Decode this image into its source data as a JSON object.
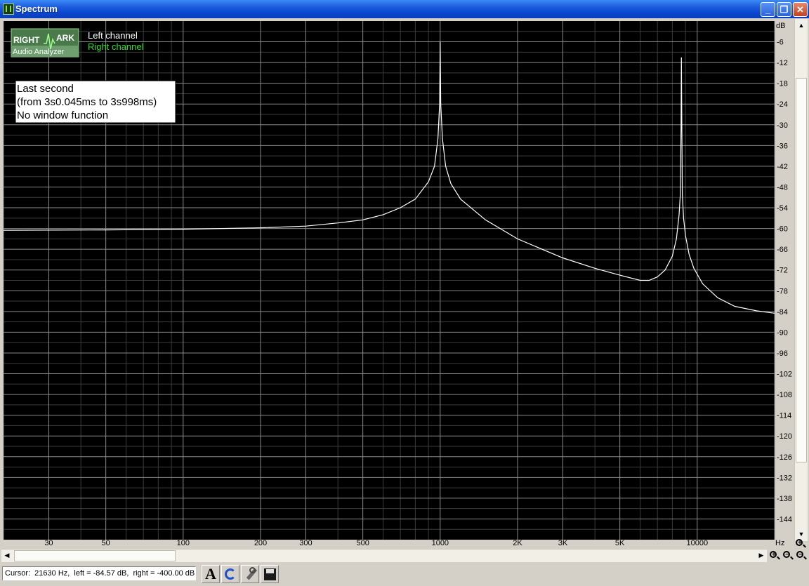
{
  "window": {
    "title": "Spectrum",
    "controls": {
      "minimize": "_",
      "maximize": "❐",
      "close": "✕"
    }
  },
  "logo": {
    "line1": "RIGHT",
    "line2": "ARK",
    "line3": "Audio Analyzer"
  },
  "legend": [
    {
      "label": "Left channel",
      "color": "#ffffff"
    },
    {
      "label": "Right channel",
      "color": "#33dd33"
    }
  ],
  "info_box": [
    "Last second",
    "(from 3s0.045ms to 3s998ms)",
    "No window function"
  ],
  "status": {
    "cursor_text": "Cursor:  21630 Hz,  left = -84.57 dB,  right = -400.00 dB"
  },
  "colors": {
    "plot_background": "#000000",
    "major_grid": "#8a8a8a",
    "minor_grid": "#3c3c3c",
    "left_trace": "#ffffff",
    "axis_background": "#d4d0c8"
  },
  "chart_data": {
    "type": "line",
    "x_scale": "log",
    "xlim": [
      20,
      20000
    ],
    "ylim": [
      -150,
      0
    ],
    "ylabel": "dB",
    "xlabel": "Hz",
    "x_ticks": [
      {
        "v": 30,
        "label": "30"
      },
      {
        "v": 50,
        "label": "50"
      },
      {
        "v": 100,
        "label": "100"
      },
      {
        "v": 200,
        "label": "200"
      },
      {
        "v": 300,
        "label": "300"
      },
      {
        "v": 500,
        "label": "500"
      },
      {
        "v": 1000,
        "label": "1000"
      },
      {
        "v": 2000,
        "label": "2K"
      },
      {
        "v": 3000,
        "label": "3K"
      },
      {
        "v": 5000,
        "label": "5K"
      },
      {
        "v": 10000,
        "label": "10000"
      }
    ],
    "y_ticks": [
      -6,
      -12,
      -18,
      -24,
      -30,
      -36,
      -42,
      -48,
      -54,
      -60,
      -66,
      -72,
      -78,
      -84,
      -90,
      -96,
      -102,
      -108,
      -114,
      -120,
      -126,
      -132,
      -138,
      -144
    ],
    "grid": true,
    "series": [
      {
        "name": "Left channel",
        "points": [
          [
            20,
            -60.5
          ],
          [
            50,
            -60.4
          ],
          [
            100,
            -60.2
          ],
          [
            200,
            -59.8
          ],
          [
            300,
            -59.3
          ],
          [
            400,
            -58.4
          ],
          [
            500,
            -57.5
          ],
          [
            600,
            -56.0
          ],
          [
            700,
            -54.0
          ],
          [
            800,
            -51.5
          ],
          [
            900,
            -46.5
          ],
          [
            950,
            -42.0
          ],
          [
            980,
            -34.0
          ],
          [
            995,
            -24.0
          ],
          [
            1000,
            -6.0
          ],
          [
            1005,
            -24.0
          ],
          [
            1020,
            -34.0
          ],
          [
            1050,
            -42.0
          ],
          [
            1100,
            -47.0
          ],
          [
            1200,
            -51.5
          ],
          [
            1500,
            -57.5
          ],
          [
            2000,
            -63.0
          ],
          [
            3000,
            -68.5
          ],
          [
            4000,
            -71.5
          ],
          [
            5000,
            -73.5
          ],
          [
            6000,
            -75.0
          ],
          [
            6500,
            -75.0
          ],
          [
            7000,
            -74.0
          ],
          [
            7500,
            -72.0
          ],
          [
            8000,
            -68.0
          ],
          [
            8300,
            -63.0
          ],
          [
            8500,
            -56.0
          ],
          [
            8600,
            -50.0
          ],
          [
            8650,
            -30.0
          ],
          [
            8680,
            -10.5
          ],
          [
            8710,
            -30.0
          ],
          [
            8750,
            -50.0
          ],
          [
            8850,
            -57.0
          ],
          [
            9000,
            -62.0
          ],
          [
            9300,
            -67.5
          ],
          [
            9700,
            -71.5
          ],
          [
            10500,
            -76.0
          ],
          [
            12000,
            -80.0
          ],
          [
            14000,
            -82.5
          ],
          [
            17000,
            -83.8
          ],
          [
            20000,
            -84.5
          ]
        ]
      }
    ]
  }
}
